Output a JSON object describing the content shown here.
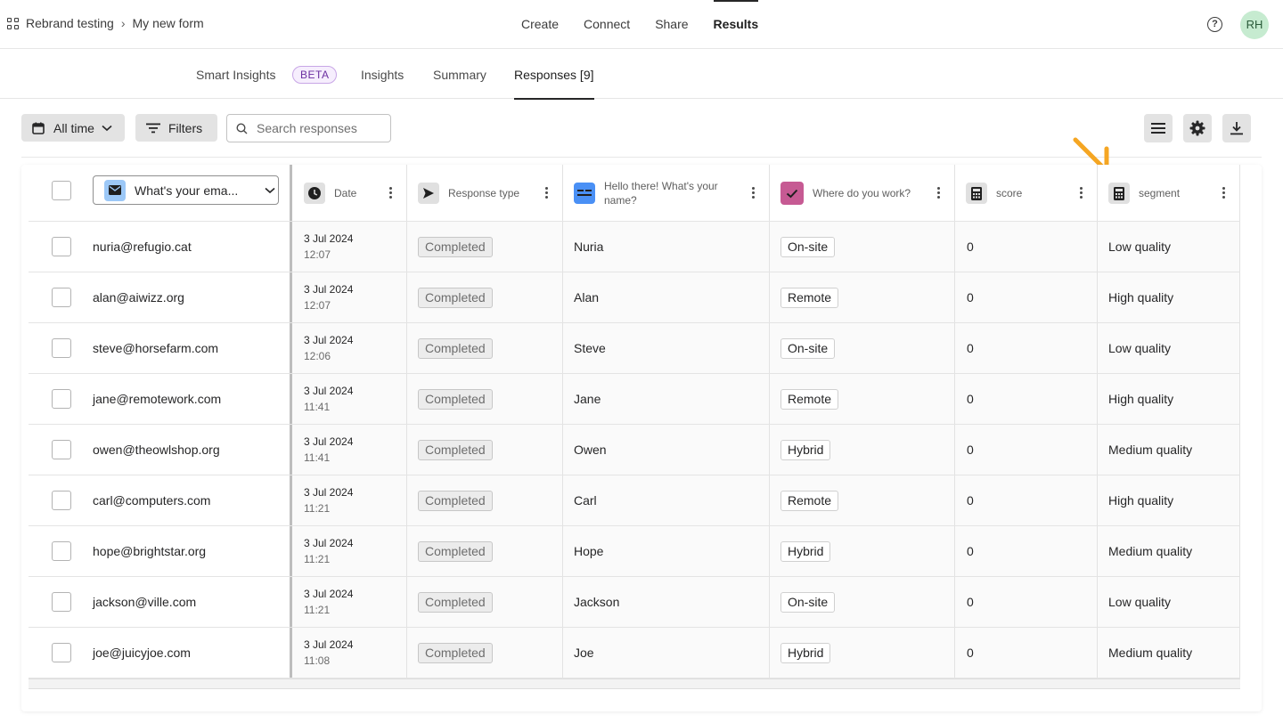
{
  "breadcrumb": {
    "workspace": "Rebrand testing",
    "form": "My new form"
  },
  "main_nav": [
    {
      "label": "Create",
      "active": false
    },
    {
      "label": "Connect",
      "active": false
    },
    {
      "label": "Share",
      "active": false
    },
    {
      "label": "Results",
      "active": true
    }
  ],
  "user": {
    "initials": "RH"
  },
  "sub_tabs": {
    "smart_insights": "Smart Insights",
    "beta": "BETA",
    "insights": "Insights",
    "summary": "Summary",
    "responses": "Responses [9]"
  },
  "toolbar": {
    "date_filter": "All time",
    "filters": "Filters",
    "search_placeholder": "Search responses"
  },
  "columns": {
    "email": "What's your ema...",
    "date": "Date",
    "response_type": "Response type",
    "name": "Hello there! What's your name?",
    "work": "Where do you work?",
    "score": "score",
    "segment": "segment"
  },
  "colors": {
    "accent_arrow": "#f5a623",
    "name_icon": "#4a90f5",
    "work_icon": "#c65a93",
    "email_icon": "#9cc8f7"
  },
  "rows": [
    {
      "email": "nuria@refugio.cat",
      "date": "3 Jul 2024",
      "time": "12:07",
      "status": "Completed",
      "name": "Nuria",
      "work": "On-site",
      "score": "0",
      "segment": "Low quality"
    },
    {
      "email": "alan@aiwizz.org",
      "date": "3 Jul 2024",
      "time": "12:07",
      "status": "Completed",
      "name": "Alan",
      "work": "Remote",
      "score": "0",
      "segment": "High quality"
    },
    {
      "email": "steve@horsefarm.com",
      "date": "3 Jul 2024",
      "time": "12:06",
      "status": "Completed",
      "name": "Steve",
      "work": "On-site",
      "score": "0",
      "segment": "Low quality"
    },
    {
      "email": "jane@remotework.com",
      "date": "3 Jul 2024",
      "time": "11:41",
      "status": "Completed",
      "name": "Jane",
      "work": "Remote",
      "score": "0",
      "segment": "High quality"
    },
    {
      "email": "owen@theowlshop.org",
      "date": "3 Jul 2024",
      "time": "11:41",
      "status": "Completed",
      "name": "Owen",
      "work": "Hybrid",
      "score": "0",
      "segment": "Medium quality"
    },
    {
      "email": "carl@computers.com",
      "date": "3 Jul 2024",
      "time": "11:21",
      "status": "Completed",
      "name": "Carl",
      "work": "Remote",
      "score": "0",
      "segment": "High quality"
    },
    {
      "email": "hope@brightstar.org",
      "date": "3 Jul 2024",
      "time": "11:21",
      "status": "Completed",
      "name": "Hope",
      "work": "Hybrid",
      "score": "0",
      "segment": "Medium quality"
    },
    {
      "email": "jackson@ville.com",
      "date": "3 Jul 2024",
      "time": "11:21",
      "status": "Completed",
      "name": "Jackson",
      "work": "On-site",
      "score": "0",
      "segment": "Low quality"
    },
    {
      "email": "joe@juicyjoe.com",
      "date": "3 Jul 2024",
      "time": "11:08",
      "status": "Completed",
      "name": "Joe",
      "work": "Hybrid",
      "score": "0",
      "segment": "Medium quality"
    }
  ]
}
